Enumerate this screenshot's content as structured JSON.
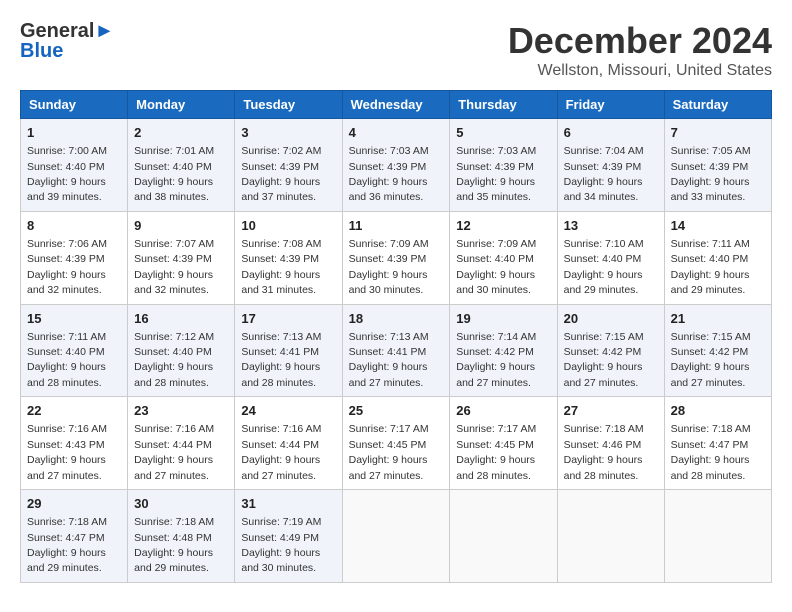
{
  "logo": {
    "line1": "General",
    "line2": "Blue"
  },
  "title": "December 2024",
  "subtitle": "Wellston, Missouri, United States",
  "days_of_week": [
    "Sunday",
    "Monday",
    "Tuesday",
    "Wednesday",
    "Thursday",
    "Friday",
    "Saturday"
  ],
  "weeks": [
    [
      {
        "day": "1",
        "sunrise": "Sunrise: 7:00 AM",
        "sunset": "Sunset: 4:40 PM",
        "daylight": "Daylight: 9 hours and 39 minutes."
      },
      {
        "day": "2",
        "sunrise": "Sunrise: 7:01 AM",
        "sunset": "Sunset: 4:40 PM",
        "daylight": "Daylight: 9 hours and 38 minutes."
      },
      {
        "day": "3",
        "sunrise": "Sunrise: 7:02 AM",
        "sunset": "Sunset: 4:39 PM",
        "daylight": "Daylight: 9 hours and 37 minutes."
      },
      {
        "day": "4",
        "sunrise": "Sunrise: 7:03 AM",
        "sunset": "Sunset: 4:39 PM",
        "daylight": "Daylight: 9 hours and 36 minutes."
      },
      {
        "day": "5",
        "sunrise": "Sunrise: 7:03 AM",
        "sunset": "Sunset: 4:39 PM",
        "daylight": "Daylight: 9 hours and 35 minutes."
      },
      {
        "day": "6",
        "sunrise": "Sunrise: 7:04 AM",
        "sunset": "Sunset: 4:39 PM",
        "daylight": "Daylight: 9 hours and 34 minutes."
      },
      {
        "day": "7",
        "sunrise": "Sunrise: 7:05 AM",
        "sunset": "Sunset: 4:39 PM",
        "daylight": "Daylight: 9 hours and 33 minutes."
      }
    ],
    [
      {
        "day": "8",
        "sunrise": "Sunrise: 7:06 AM",
        "sunset": "Sunset: 4:39 PM",
        "daylight": "Daylight: 9 hours and 32 minutes."
      },
      {
        "day": "9",
        "sunrise": "Sunrise: 7:07 AM",
        "sunset": "Sunset: 4:39 PM",
        "daylight": "Daylight: 9 hours and 32 minutes."
      },
      {
        "day": "10",
        "sunrise": "Sunrise: 7:08 AM",
        "sunset": "Sunset: 4:39 PM",
        "daylight": "Daylight: 9 hours and 31 minutes."
      },
      {
        "day": "11",
        "sunrise": "Sunrise: 7:09 AM",
        "sunset": "Sunset: 4:39 PM",
        "daylight": "Daylight: 9 hours and 30 minutes."
      },
      {
        "day": "12",
        "sunrise": "Sunrise: 7:09 AM",
        "sunset": "Sunset: 4:40 PM",
        "daylight": "Daylight: 9 hours and 30 minutes."
      },
      {
        "day": "13",
        "sunrise": "Sunrise: 7:10 AM",
        "sunset": "Sunset: 4:40 PM",
        "daylight": "Daylight: 9 hours and 29 minutes."
      },
      {
        "day": "14",
        "sunrise": "Sunrise: 7:11 AM",
        "sunset": "Sunset: 4:40 PM",
        "daylight": "Daylight: 9 hours and 29 minutes."
      }
    ],
    [
      {
        "day": "15",
        "sunrise": "Sunrise: 7:11 AM",
        "sunset": "Sunset: 4:40 PM",
        "daylight": "Daylight: 9 hours and 28 minutes."
      },
      {
        "day": "16",
        "sunrise": "Sunrise: 7:12 AM",
        "sunset": "Sunset: 4:40 PM",
        "daylight": "Daylight: 9 hours and 28 minutes."
      },
      {
        "day": "17",
        "sunrise": "Sunrise: 7:13 AM",
        "sunset": "Sunset: 4:41 PM",
        "daylight": "Daylight: 9 hours and 28 minutes."
      },
      {
        "day": "18",
        "sunrise": "Sunrise: 7:13 AM",
        "sunset": "Sunset: 4:41 PM",
        "daylight": "Daylight: 9 hours and 27 minutes."
      },
      {
        "day": "19",
        "sunrise": "Sunrise: 7:14 AM",
        "sunset": "Sunset: 4:42 PM",
        "daylight": "Daylight: 9 hours and 27 minutes."
      },
      {
        "day": "20",
        "sunrise": "Sunrise: 7:15 AM",
        "sunset": "Sunset: 4:42 PM",
        "daylight": "Daylight: 9 hours and 27 minutes."
      },
      {
        "day": "21",
        "sunrise": "Sunrise: 7:15 AM",
        "sunset": "Sunset: 4:42 PM",
        "daylight": "Daylight: 9 hours and 27 minutes."
      }
    ],
    [
      {
        "day": "22",
        "sunrise": "Sunrise: 7:16 AM",
        "sunset": "Sunset: 4:43 PM",
        "daylight": "Daylight: 9 hours and 27 minutes."
      },
      {
        "day": "23",
        "sunrise": "Sunrise: 7:16 AM",
        "sunset": "Sunset: 4:44 PM",
        "daylight": "Daylight: 9 hours and 27 minutes."
      },
      {
        "day": "24",
        "sunrise": "Sunrise: 7:16 AM",
        "sunset": "Sunset: 4:44 PM",
        "daylight": "Daylight: 9 hours and 27 minutes."
      },
      {
        "day": "25",
        "sunrise": "Sunrise: 7:17 AM",
        "sunset": "Sunset: 4:45 PM",
        "daylight": "Daylight: 9 hours and 27 minutes."
      },
      {
        "day": "26",
        "sunrise": "Sunrise: 7:17 AM",
        "sunset": "Sunset: 4:45 PM",
        "daylight": "Daylight: 9 hours and 28 minutes."
      },
      {
        "day": "27",
        "sunrise": "Sunrise: 7:18 AM",
        "sunset": "Sunset: 4:46 PM",
        "daylight": "Daylight: 9 hours and 28 minutes."
      },
      {
        "day": "28",
        "sunrise": "Sunrise: 7:18 AM",
        "sunset": "Sunset: 4:47 PM",
        "daylight": "Daylight: 9 hours and 28 minutes."
      }
    ],
    [
      {
        "day": "29",
        "sunrise": "Sunrise: 7:18 AM",
        "sunset": "Sunset: 4:47 PM",
        "daylight": "Daylight: 9 hours and 29 minutes."
      },
      {
        "day": "30",
        "sunrise": "Sunrise: 7:18 AM",
        "sunset": "Sunset: 4:48 PM",
        "daylight": "Daylight: 9 hours and 29 minutes."
      },
      {
        "day": "31",
        "sunrise": "Sunrise: 7:19 AM",
        "sunset": "Sunset: 4:49 PM",
        "daylight": "Daylight: 9 hours and 30 minutes."
      },
      null,
      null,
      null,
      null
    ]
  ]
}
